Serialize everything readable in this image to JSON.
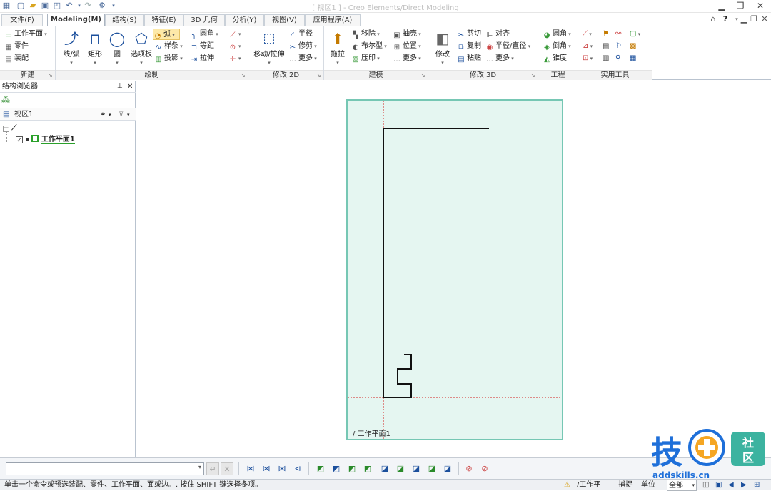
{
  "window": {
    "title": "[ 视区1 ] - Creo Elements/Direct Modeling"
  },
  "tabs": [
    {
      "label": "文件(F)"
    },
    {
      "label": "Modeling(M)"
    },
    {
      "label": "结构(S)"
    },
    {
      "label": "特征(E)"
    },
    {
      "label": "3D 几何"
    },
    {
      "label": "分析(Y)"
    },
    {
      "label": "视图(V)"
    },
    {
      "label": "应用程序(A)"
    }
  ],
  "ribbon": {
    "new": {
      "label": "新建",
      "items": [
        "工作平面",
        "零件",
        "装配"
      ]
    },
    "sketch": {
      "label": "绘制",
      "big": [
        "线/弧",
        "矩形",
        "圆",
        "选项板"
      ],
      "small": [
        "弧",
        "样条",
        "投影",
        "圆角",
        "等距",
        "拉伸"
      ]
    },
    "modify2d": {
      "label": "修改 2D",
      "big": "移动/拉伸",
      "small": [
        "半径",
        "修剪",
        "更多"
      ]
    },
    "build": {
      "label": "建模",
      "big": "拖拉",
      "small": [
        "移除",
        "布尔型",
        "压印",
        "抽壳",
        "位置",
        "更多"
      ]
    },
    "modify3d": {
      "label": "修改 3D",
      "big": "修改",
      "small": [
        "剪切",
        "复制",
        "粘贴",
        "对齐",
        "半径/直径",
        "更多"
      ]
    },
    "engineering": {
      "label": "工程",
      "small": [
        "圆角",
        "倒角",
        "锥度"
      ]
    },
    "utilities": {
      "label": "实用工具"
    }
  },
  "browser": {
    "title": "结构浏览器",
    "view": "视区1",
    "workplane": "工作平面1"
  },
  "viewport": {
    "workplane_label": "/ 工作平面1"
  },
  "status": {
    "message": "单击一个命令或预选装配、零件、工作平面、面或边。. 按住 SHIFT 键选择多项。",
    "workplane": "/工作平",
    "snap": "捕捉",
    "units": "单位",
    "filter": "全部"
  },
  "watermark": {
    "domain": "addskills.cn"
  },
  "colors": {
    "sheet_fill": "#e5f6f1",
    "sheet_border": "#76c7b4",
    "axis": "#d42020",
    "ribbon_accent": "#1b4f9c"
  }
}
